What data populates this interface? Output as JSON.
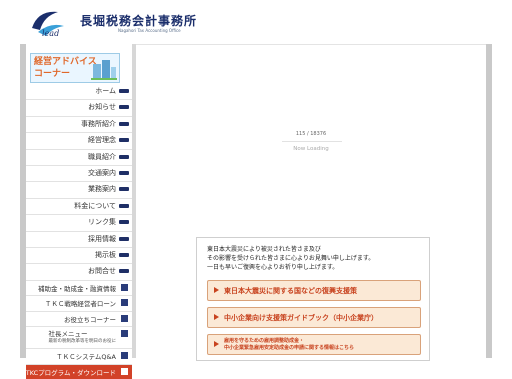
{
  "header": {
    "title": "長堀税務会計事務所",
    "subtitle": "Nagahori Tax Accounting Office"
  },
  "sidebar": {
    "banner": {
      "line1": "経営アドバイス",
      "line2": "コーナー"
    },
    "nav": [
      {
        "label": "ホーム"
      },
      {
        "label": "お知らせ"
      },
      {
        "label": "事務所紹介"
      },
      {
        "label": "経営理念"
      },
      {
        "label": "職員紹介"
      },
      {
        "label": "交通案内"
      },
      {
        "label": "業務案内"
      },
      {
        "label": "料金について"
      },
      {
        "label": "リンク集"
      },
      {
        "label": "採用情報"
      },
      {
        "label": "掲示板"
      },
      {
        "label": "お問合せ"
      }
    ],
    "ext_links": [
      {
        "label": "補助金・助成金・融資情報"
      },
      {
        "label": "ＴＫＣ戦略経営者ローン"
      },
      {
        "label": "お役立ちコーナー"
      },
      {
        "label": "社長メニュー",
        "small": "最新の税制改革等を明日のお役に"
      },
      {
        "label": "ＴＫＣシステムQ&A"
      },
      {
        "label": "TKCプログラム・ダウンロード"
      }
    ]
  },
  "main": {
    "loading_count": "115 / 18376",
    "loading_text": "Now Loading",
    "notice_lines": [
      "東日本大震災により被災された皆さま及び",
      "その影響を受けられた皆さまに心よりお見舞い申し上げます。",
      "一日も早いご復興を心よりお祈り申し上げます。"
    ],
    "buttons": [
      {
        "label": "東日本大震災に関する国などの復興支援策"
      },
      {
        "label": "中小企業向け支援策ガイドブック（中小企業庁）"
      },
      {
        "line1": "雇用を守るための雇用調整助成金・",
        "line2": "中小企業緊急雇用安定助成金の申請に関する情報はこちら"
      }
    ]
  },
  "colors": {
    "accent_navy": "#1f2f66",
    "accent_orange": "#c8431f",
    "frame_gray": "#c9c9c9"
  }
}
